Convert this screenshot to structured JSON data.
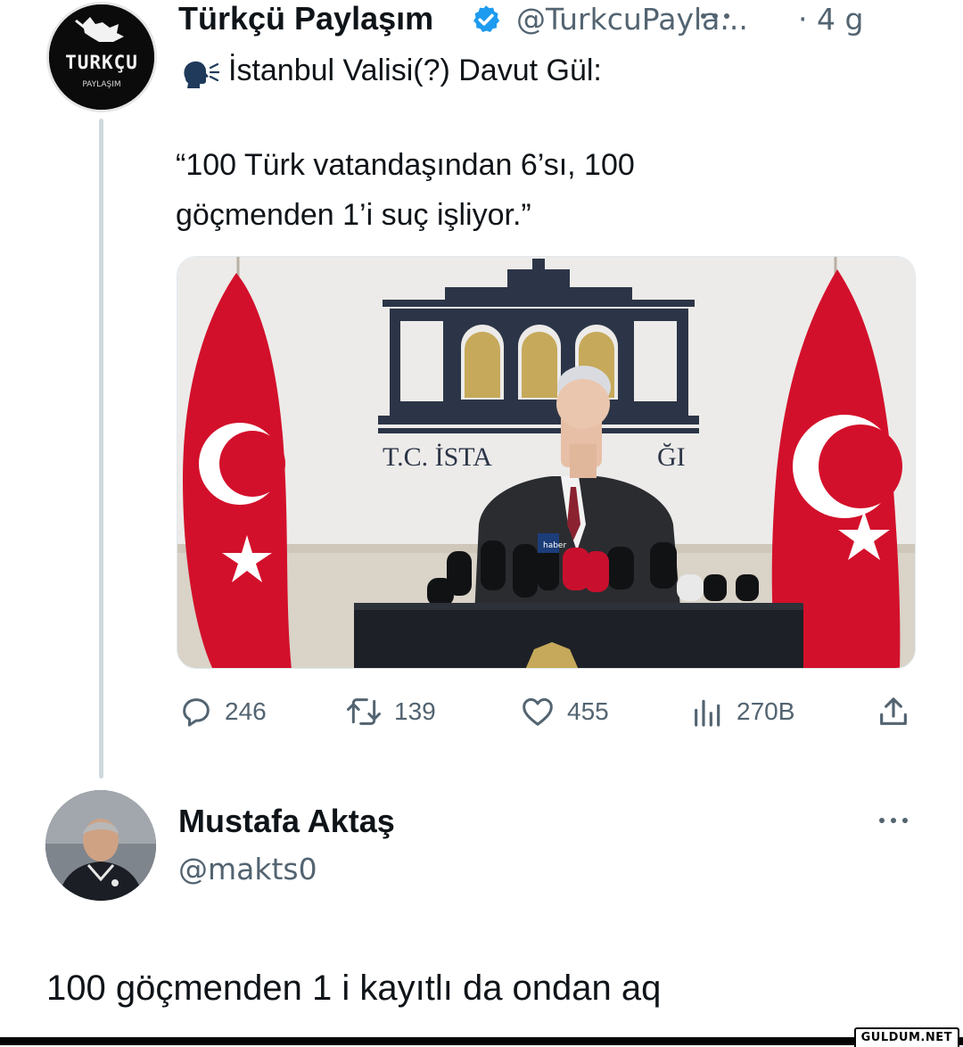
{
  "tweet": {
    "author": {
      "display_name": "Türkçü Paylaşım",
      "handle": "@TurkcuPayla...",
      "time": "· 4 g",
      "verified": true,
      "avatar_logo_text": "TURKÇU",
      "avatar_logo_subtext": "PAYLAŞIM"
    },
    "text_line_1": "İstanbul Valisi(?) Davut Gül:",
    "quote_line_1": "“100 Türk vatandaşından 6’sı, 100",
    "quote_line_2": "göçmenden 1’i suç işliyor.”",
    "media": {
      "backdrop_text": "T.C. İSTA",
      "backdrop_text_end": "ĞI",
      "mic_label": "haber"
    },
    "actions": {
      "replies": "246",
      "retweets": "139",
      "likes": "455",
      "views": "270B"
    }
  },
  "reply": {
    "author": {
      "display_name": "Mustafa Aktaş",
      "handle": "@makts0"
    },
    "text": "100 göçmenden 1 i kayıtlı da ondan aq"
  },
  "watermark": "GULDUM.NET",
  "colors": {
    "text_primary": "#0f1419",
    "text_secondary": "#536471",
    "verified": "#1d9bf0",
    "flag_red": "#d3102b",
    "thread_line": "#cfd9de"
  },
  "icons": {
    "verified": "verified-badge-icon",
    "speaking": "speaking-head-icon",
    "reply": "comment-bubble-icon",
    "retweet": "retweet-icon",
    "like": "heart-icon",
    "views": "bar-chart-icon",
    "share": "share-upload-icon",
    "more": "more-dots-icon"
  }
}
